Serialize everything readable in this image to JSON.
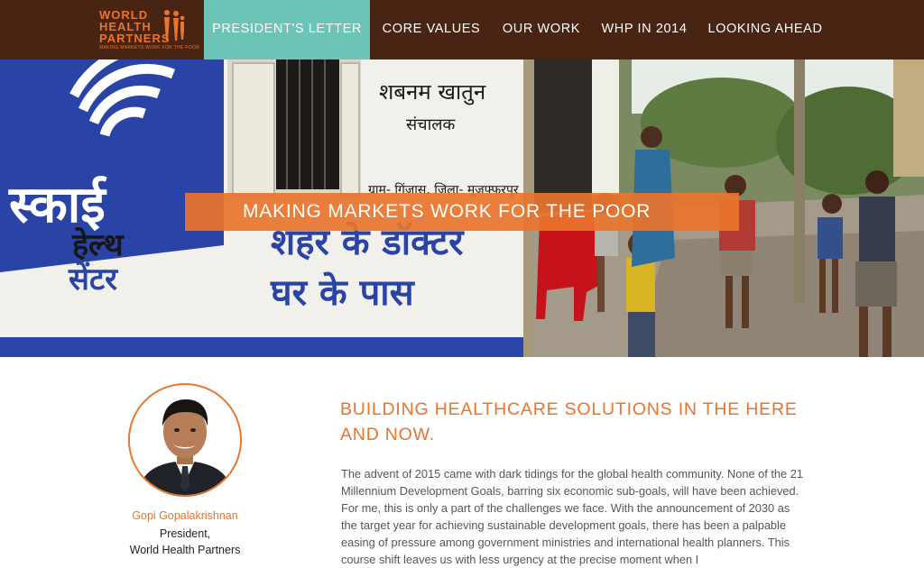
{
  "logo": {
    "line1": "WORLD",
    "line2": "HEALTH",
    "line3": "PARTNERS",
    "tagline": "MAKING MARKETS WORK FOR THE POOR"
  },
  "nav": {
    "items": [
      {
        "label": "PRESIDENT'S LETTER",
        "active": true
      },
      {
        "label": "CORE VALUES",
        "active": false
      },
      {
        "label": "OUR WORK",
        "active": false
      },
      {
        "label": "WHP IN 2014",
        "active": false
      },
      {
        "label": "LOOKING AHEAD",
        "active": false
      }
    ]
  },
  "hero": {
    "banner": "MAKING MARKETS WORK FOR THE POOR",
    "wall_text": {
      "sky_brand": "स्काई",
      "health": "हेल्थ",
      "center": "सेंटर",
      "slogan_1": "शहर के डॉक्टर",
      "slogan_2": "घर के पास",
      "name": "शबनम खातुन",
      "role": "संचालक",
      "address": "ग्राम- गिंजास, जिला- मुजफ्फरपुर"
    }
  },
  "president": {
    "name": "Gopi Gopalakrishnan",
    "title": "President,",
    "org": "World Health Partners"
  },
  "article": {
    "title": "BUILDING HEALTHCARE SOLUTIONS IN THE HERE AND NOW.",
    "body": "The advent of 2015 came with dark tidings for the global health community. None of the 21 Millennium Development Goals, barring six economic sub-goals, will have been achieved. For me, this is only a part of the challenges we face. With the announcement of 2030 as the target year for achieving sustainable development goals, there has been a palpable easing of pressure among government ministries and international health planners. This course shift leaves us with less urgency at the precise moment when I"
  },
  "colors": {
    "nav_bg": "#4a2412",
    "active_tab": "#6cc4b7",
    "accent_orange": "#e9742c",
    "body_text": "#555555"
  }
}
